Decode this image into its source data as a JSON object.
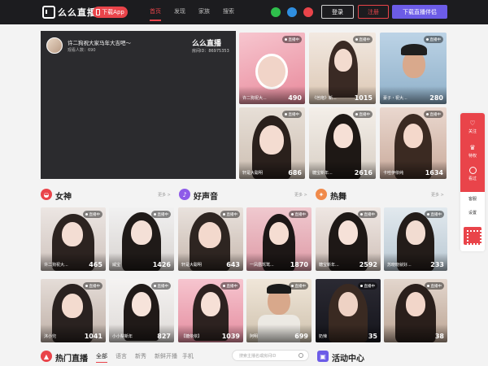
{
  "header": {
    "logo_text": "么么直播",
    "download_app": "下载App",
    "nav": [
      "首页",
      "发现",
      "家族",
      "搜索"
    ],
    "login": "登录",
    "register": "注册",
    "download_companion": "下载直播伴侣"
  },
  "player": {
    "title": "许二狗祝大家马年大吉吧～",
    "viewers": "观看人数：690",
    "brand": "么么直播",
    "room": "房间ID：86975353"
  },
  "live_badge": "直播中",
  "featured": [
    {
      "name": "许二狗祝大...",
      "count": "490"
    },
    {
      "name": "《芭拖》新...",
      "count": "1015"
    },
    {
      "name": "豪子・祝大...",
      "count": "280"
    },
    {
      "name": "轩是大聪明",
      "count": "686"
    },
    {
      "name": "糖宝新年...",
      "count": "2616"
    },
    {
      "name": "卡哇伊依纯",
      "count": "1634"
    }
  ],
  "sections": {
    "goddess": "女神",
    "good_voice": "好声音",
    "hot_dance": "热舞",
    "more": "更多 >"
  },
  "row1": [
    {
      "name": "许二狗祝大...",
      "count": "465"
    },
    {
      "name": "威宝",
      "count": "1426"
    },
    {
      "name": "轩是大聪明",
      "count": "643"
    },
    {
      "name": "一凤凰驾鹫...",
      "count": "1870"
    },
    {
      "name": "糖宝新年...",
      "count": "2592"
    },
    {
      "name": "苏晓晓就好...",
      "count": "233"
    }
  ],
  "row2": [
    {
      "name": "沐小兜",
      "count": "1041"
    },
    {
      "name": "小小梨新年",
      "count": "827"
    },
    {
      "name": "【糖依依】",
      "count": "1039"
    },
    {
      "name": "阿明",
      "count": "699"
    },
    {
      "name": "奶辣",
      "count": "35"
    },
    {
      "name": "",
      "count": "38"
    }
  ],
  "bottom": {
    "hot_live": "热门直播",
    "tabs": [
      "全部",
      "语言",
      "新秀",
      "新鲜开播",
      "手机"
    ],
    "search_placeholder": "搜索主播名或房间ID",
    "activity": "活动中心"
  },
  "float": {
    "follow": "关注",
    "privilege": "特权",
    "watched": "看过",
    "service": "客服",
    "settings": "设置"
  },
  "colors": {
    "accent": "#e9444a",
    "purple": "#6c5ce7",
    "dark": "#1c1c1f"
  }
}
